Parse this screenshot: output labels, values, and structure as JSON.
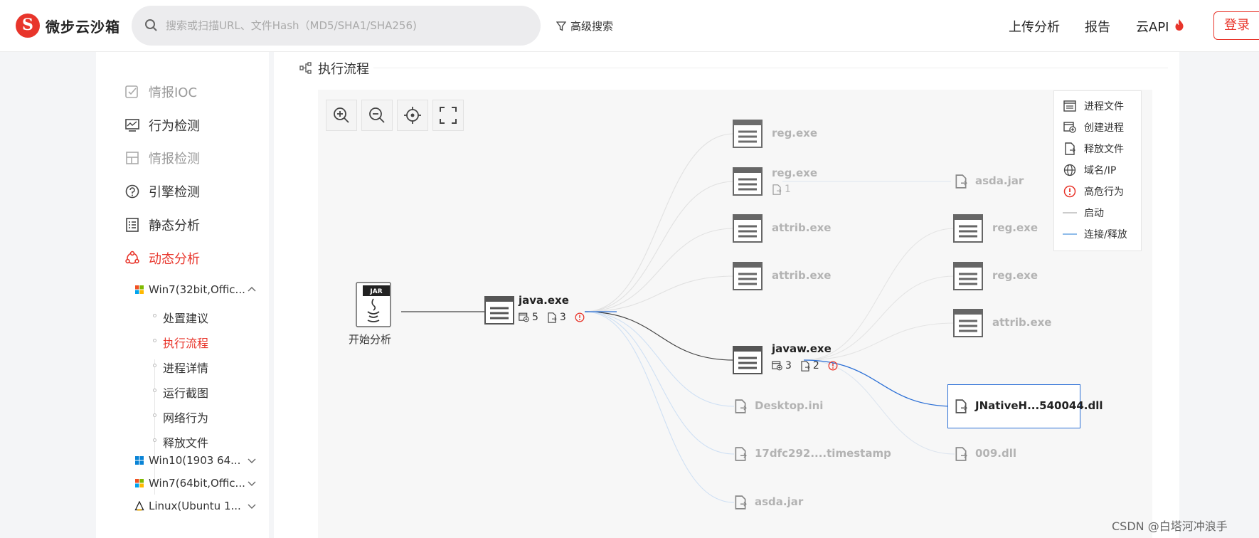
{
  "header": {
    "logo_text": "微步云沙箱",
    "logo_glyph": "S",
    "search_placeholder": "搜索或扫描URL、文件Hash（MD5/SHA1/SHA256)",
    "advanced_search": "高级搜索",
    "nav": {
      "upload": "上传分析",
      "report": "报告",
      "api": "云API"
    },
    "login": "登录",
    "accent": "#e8352b"
  },
  "sidebar": {
    "items": [
      {
        "label": "情报IOC",
        "icon": "edit-check-icon",
        "state": "dim"
      },
      {
        "label": "行为检测",
        "icon": "monitor-chart-icon",
        "state": "normal"
      },
      {
        "label": "情报检测",
        "icon": "layout-icon",
        "state": "dim"
      },
      {
        "label": "引擎检测",
        "icon": "gauge-icon",
        "state": "normal"
      },
      {
        "label": "静态分析",
        "icon": "list-doc-icon",
        "state": "normal"
      },
      {
        "label": "动态分析",
        "icon": "share-nodes-icon",
        "state": "active"
      }
    ],
    "environments": [
      {
        "label": "Win7(32bit,Offic...",
        "expanded": true
      },
      {
        "label": "Win10(1903 64...",
        "expanded": false
      },
      {
        "label": "Win7(64bit,Offic...",
        "expanded": false
      },
      {
        "label": "Linux(Ubuntu 1...",
        "expanded": false
      }
    ],
    "sub_items": [
      "处置建议",
      "执行流程",
      "进程详情",
      "运行截图",
      "网络行为",
      "释放文件"
    ],
    "active_sub": "执行流程"
  },
  "main": {
    "section_title": "执行流程",
    "legend": [
      {
        "label": "进程文件",
        "icon": "process-file-icon"
      },
      {
        "label": "创建进程",
        "icon": "create-process-icon"
      },
      {
        "label": "释放文件",
        "icon": "release-file-icon"
      },
      {
        "label": "域名/IP",
        "icon": "globe-icon"
      },
      {
        "label": "高危行为",
        "icon": "alert-circle-icon"
      },
      {
        "label": "启动",
        "icon": "gray-line-icon"
      },
      {
        "label": "连接/释放",
        "icon": "blue-line-icon"
      }
    ],
    "graph": {
      "start": {
        "badge": "JAR",
        "label": "开始分析"
      },
      "root": {
        "label": "java.exe",
        "create": "5",
        "release": "3",
        "alert": true
      },
      "level1": [
        {
          "label": "reg.exe",
          "type": "process"
        },
        {
          "label": "reg.exe",
          "type": "process",
          "release": "1"
        },
        {
          "label": "attrib.exe",
          "type": "process"
        },
        {
          "label": "attrib.exe",
          "type": "process"
        },
        {
          "label": "javaw.exe",
          "type": "process",
          "create": "3",
          "release": "2",
          "alert": true
        },
        {
          "label": "Desktop.ini",
          "type": "file"
        },
        {
          "label": "17dfc292....timestamp",
          "type": "file"
        },
        {
          "label": "asda.jar",
          "type": "file"
        }
      ],
      "level2": [
        {
          "label": "asda.jar",
          "type": "file"
        },
        {
          "label": "reg.exe",
          "type": "process"
        },
        {
          "label": "reg.exe",
          "type": "process"
        },
        {
          "label": "attrib.exe",
          "type": "process"
        },
        {
          "label": "JNativeH...540044.dll",
          "type": "file",
          "selected": true
        },
        {
          "label": "009.dll",
          "type": "file"
        }
      ]
    }
  },
  "watermark": "CSDN @白塔河冲浪手"
}
